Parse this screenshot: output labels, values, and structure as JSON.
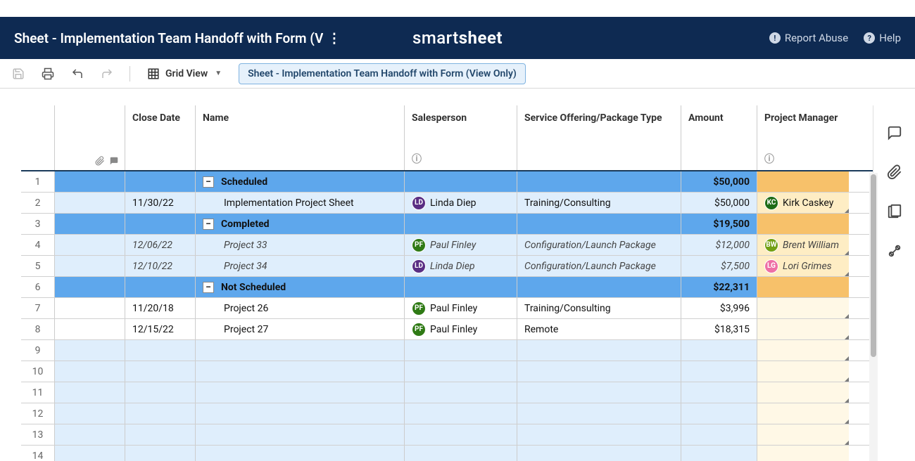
{
  "header": {
    "title": "Sheet - Implementation Team Handoff with Form (V",
    "logo_prefix": "smart",
    "logo_suffix": "sheet",
    "report_abuse": "Report Abuse",
    "help": "Help"
  },
  "toolbar": {
    "view_label": "Grid View",
    "tooltip": "Sheet - Implementation Team Handoff with Form (View Only)"
  },
  "columns": {
    "close_date": "Close Date",
    "name": "Name",
    "salesperson": "Salesperson",
    "service": "Service Offering/Package Type",
    "amount": "Amount",
    "pm": "Project Manager"
  },
  "rows": [
    {
      "n": "1",
      "type": "group",
      "name": "Scheduled",
      "amount": "$50,000"
    },
    {
      "n": "2",
      "type": "data",
      "close": "11/30/22",
      "name": "Implementation Project Sheet",
      "sales_initials": "LD",
      "sales_cls": "av-ld",
      "sales": "Linda Diep",
      "service": "Training/Consulting",
      "amount": "$50,000",
      "pm_initials": "KC",
      "pm_cls": "av-kc",
      "pm": "Kirk Caskey"
    },
    {
      "n": "3",
      "type": "group",
      "name": "Completed",
      "amount": "$19,500"
    },
    {
      "n": "4",
      "type": "ital",
      "close": "12/06/22",
      "name": "Project 33",
      "sales_initials": "PF",
      "sales_cls": "av-pf",
      "sales": "Paul Finley",
      "service": "Configuration/Launch Package",
      "amount": "$12,000",
      "pm_initials": "BW",
      "pm_cls": "av-bw",
      "pm": "Brent William"
    },
    {
      "n": "5",
      "type": "ital",
      "close": "12/10/22",
      "name": "Project 34",
      "sales_initials": "LD",
      "sales_cls": "av-ld",
      "sales": "Linda Diep",
      "service": "Configuration/Launch Package",
      "amount": "$7,500",
      "pm_initials": "LG",
      "pm_cls": "av-lg",
      "pm": "Lori Grimes"
    },
    {
      "n": "6",
      "type": "group",
      "name": "Not Scheduled",
      "amount": "$22,311"
    },
    {
      "n": "7",
      "type": "plain",
      "close": "11/20/18",
      "name": "Project 26",
      "sales_initials": "PF",
      "sales_cls": "av-pf",
      "sales": "Paul Finley",
      "service": "Training/Consulting",
      "amount": "$3,996"
    },
    {
      "n": "8",
      "type": "plain",
      "close": "12/15/22",
      "name": "Project 27",
      "sales_initials": "PF",
      "sales_cls": "av-pf",
      "sales": "Paul Finley",
      "service": "Remote",
      "amount": "$18,315"
    },
    {
      "n": "9",
      "type": "empty"
    },
    {
      "n": "10",
      "type": "empty"
    },
    {
      "n": "11",
      "type": "empty"
    },
    {
      "n": "12",
      "type": "empty"
    },
    {
      "n": "13",
      "type": "empty"
    },
    {
      "n": "14",
      "type": "empty"
    }
  ]
}
